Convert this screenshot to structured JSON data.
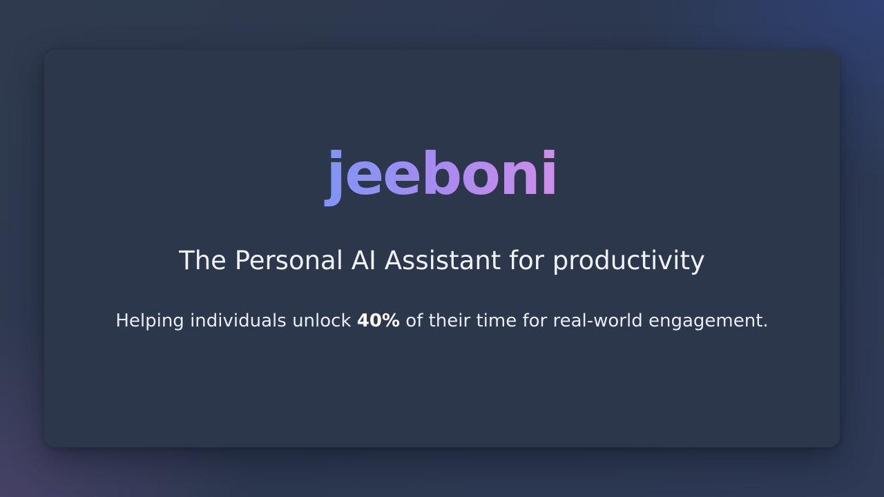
{
  "brand": {
    "logo_text": "jeeboni"
  },
  "hero": {
    "tagline": "The Personal AI Assistant for productivity",
    "subline_before": "Helping individuals unlock ",
    "subline_highlight": "40%",
    "subline_after": " of their time for real-world engagement."
  },
  "colors": {
    "background": "#2e3a50",
    "card": "#2c374c",
    "logo_gradient_start": "#7e96f4",
    "logo_gradient_end": "#cf8ee8",
    "text": "#f1f3f8"
  }
}
